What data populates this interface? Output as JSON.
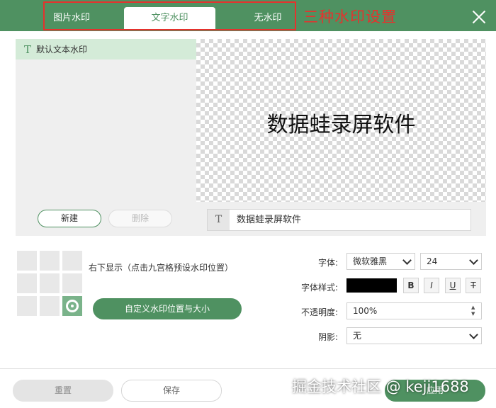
{
  "header": {
    "tabs": [
      {
        "label": "图片水印"
      },
      {
        "label": "文字水印"
      },
      {
        "label": "无水印"
      }
    ],
    "annotation": "三种水印设置"
  },
  "watermark_list": {
    "items": [
      {
        "label": "默认文本水印"
      }
    ],
    "new_label": "新建",
    "delete_label": "删除"
  },
  "preview": {
    "text": "数据蛙录屏软件"
  },
  "text_input": {
    "value": "数据蛙录屏软件"
  },
  "position": {
    "label": "右下显示（点击九宫格预设水印位置）",
    "custom_button": "自定义水印位置与大小"
  },
  "form": {
    "font_label": "字体:",
    "font_value": "微软雅黑",
    "size_value": "24",
    "style_label": "字体样式:",
    "color": "#000000",
    "style_buttons": [
      "B",
      "I",
      "U",
      "T"
    ],
    "opacity_label": "不透明度:",
    "opacity_value": "100%",
    "shadow_label": "阴影:",
    "shadow_value": "无"
  },
  "footer": {
    "reset_label": "重置",
    "save_label": "保存",
    "apply_label": "应用"
  },
  "overlay_watermark": "掘金技术社区 @ keji1688",
  "colors": {
    "accent": "#4f9161",
    "annotation": "#e5322d",
    "selected_row": "#d4ebd8"
  }
}
